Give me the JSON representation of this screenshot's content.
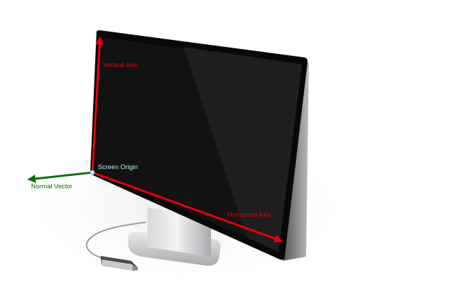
{
  "labels": {
    "vertical_axis": "Vertical Axis",
    "horizontal_axis": "Horizontal Axis",
    "screen_origin": "Screen Origin",
    "normal_vector": "Normal Vector"
  },
  "colors": {
    "axis": "#e8000b",
    "normal": "#0b6e0b",
    "origin": "#bdeef2",
    "screen": "#121212",
    "bezel": "#080808",
    "stand": "#bfc1c4",
    "background": "#ffffff"
  },
  "icons": {
    "device": "motion-sensor-icon"
  }
}
